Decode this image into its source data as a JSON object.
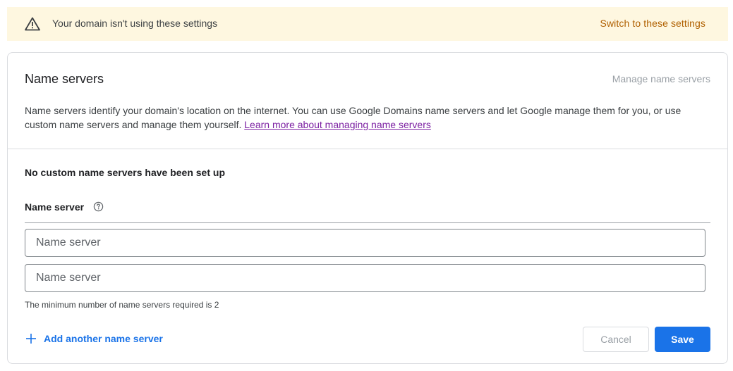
{
  "banner": {
    "icon": "warning-icon",
    "message": "Your domain isn't using these settings",
    "action_label": "Switch to these settings",
    "background": "#fef7e0",
    "action_color": "#b06000"
  },
  "card": {
    "title": "Name servers",
    "manage_label": "Manage name servers",
    "description": "Name servers identify your domain's location on the internet. You can use Google Domains name servers and let Google manage them for you, or use custom name servers and manage them yourself.",
    "learn_more_label": "Learn more about managing name servers",
    "no_custom_text": "No custom name servers have been set up",
    "field_label": "Name server",
    "field_label_icon": "help-circle-icon",
    "fields": [
      {
        "placeholder": "Name server",
        "value": ""
      },
      {
        "placeholder": "Name server",
        "value": ""
      }
    ],
    "hint": "The minimum number of name servers required is 2",
    "add_label": "Add another name server",
    "add_icon": "plus-icon",
    "cancel_label": "Cancel",
    "save_label": "Save",
    "accent_color": "#1a73e8"
  }
}
